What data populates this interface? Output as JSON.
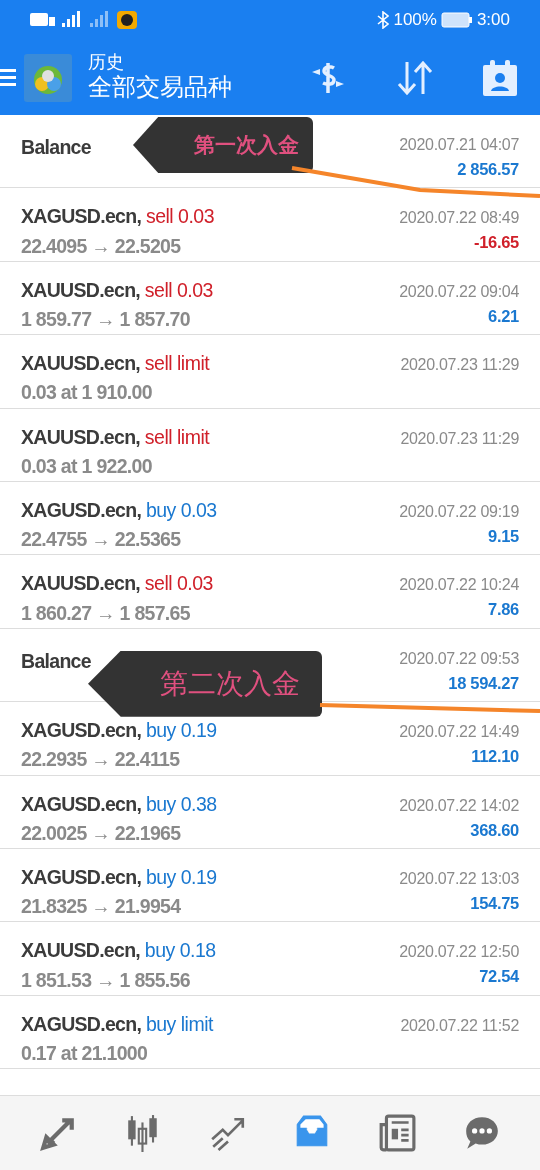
{
  "status_bar": {
    "battery": "100%",
    "time": "3:00"
  },
  "header": {
    "title": "历史",
    "subtitle": "全部交易品种"
  },
  "deals": [
    {
      "kind": "balance",
      "symbol": "Balance",
      "time": "2020.07.21 04:07",
      "profit": "2 856.57",
      "loss": false,
      "note": "第一次入金"
    },
    {
      "kind": "trade",
      "symbol": "XAGUSD.ecn,",
      "sell": true,
      "action": "sell 0.03",
      "detail": "22.4095 → 22.5205",
      "time": "2020.07.22 08:49",
      "profit": "-16.65",
      "loss": true
    },
    {
      "kind": "trade",
      "symbol": "XAUUSD.ecn,",
      "sell": true,
      "action": "sell 0.03",
      "detail": "1 859.77 → 1 857.70",
      "time": "2020.07.22 09:04",
      "profit": "6.21",
      "loss": false
    },
    {
      "kind": "trade",
      "symbol": "XAUUSD.ecn,",
      "sell": true,
      "action": "sell limit",
      "detail": "0.03 at 1 910.00",
      "time": "2020.07.23 11:29"
    },
    {
      "kind": "trade",
      "symbol": "XAUUSD.ecn,",
      "sell": true,
      "action": "sell limit",
      "detail": "0.03 at 1 922.00",
      "time": "2020.07.23 11:29"
    },
    {
      "kind": "trade",
      "symbol": "XAGUSD.ecn,",
      "sell": false,
      "action": "buy 0.03",
      "detail": "22.4755 → 22.5365",
      "time": "2020.07.22 09:19",
      "profit": "9.15",
      "loss": false
    },
    {
      "kind": "trade",
      "symbol": "XAUUSD.ecn,",
      "sell": true,
      "action": "sell 0.03",
      "detail": "1 860.27 → 1 857.65",
      "time": "2020.07.22 10:24",
      "profit": "7.86",
      "loss": false
    },
    {
      "kind": "balance",
      "symbol": "Balance",
      "time": "2020.07.22 09:53",
      "profit": "18 594.27",
      "loss": false,
      "note": "第二次入金"
    },
    {
      "kind": "trade",
      "symbol": "XAGUSD.ecn,",
      "sell": false,
      "action": "buy 0.19",
      "detail": "22.2935 → 22.4115",
      "time": "2020.07.22 14:49",
      "profit": "112.10",
      "loss": false
    },
    {
      "kind": "trade",
      "symbol": "XAGUSD.ecn,",
      "sell": false,
      "action": "buy 0.38",
      "detail": "22.0025 → 22.1965",
      "time": "2020.07.22 14:02",
      "profit": "368.60",
      "loss": false
    },
    {
      "kind": "trade",
      "symbol": "XAGUSD.ecn,",
      "sell": false,
      "action": "buy 0.19",
      "detail": "21.8325 → 21.9954",
      "time": "2020.07.22 13:03",
      "profit": "154.75",
      "loss": false
    },
    {
      "kind": "trade",
      "symbol": "XAUUSD.ecn,",
      "sell": false,
      "action": "buy 0.18",
      "detail": "1 851.53 → 1 855.56",
      "time": "2020.07.22 12:50",
      "profit": "72.54",
      "loss": false
    },
    {
      "kind": "trade",
      "symbol": "XAGUSD.ecn,",
      "sell": false,
      "action": "buy limit",
      "detail": "0.17 at 21.1000",
      "time": "2020.07.22 11:52"
    }
  ],
  "nav": [
    {
      "kind": "trade",
      "selected": false
    },
    {
      "kind": "quotes",
      "selected": false
    },
    {
      "kind": "chart",
      "selected": false
    },
    {
      "kind": "history",
      "selected": true
    },
    {
      "kind": "news",
      "selected": false
    },
    {
      "kind": "chat",
      "selected": false
    }
  ]
}
